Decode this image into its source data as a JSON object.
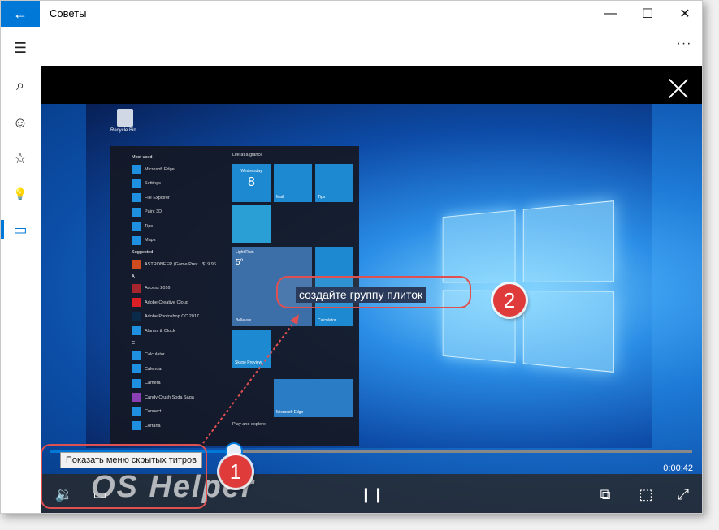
{
  "window": {
    "title": "Советы",
    "controls": {
      "minimize": "—",
      "maximize": "☐",
      "close": "✕"
    },
    "more": "···"
  },
  "nav": {
    "items": [
      {
        "icon": "hamburger-icon",
        "glyph": "☰"
      },
      {
        "icon": "search-icon",
        "glyph": "⌕"
      },
      {
        "icon": "smiley-icon",
        "glyph": "☺"
      },
      {
        "icon": "star-icon",
        "glyph": "☆"
      },
      {
        "icon": "lightbulb-icon",
        "glyph": "💡"
      },
      {
        "icon": "video-icon",
        "glyph": "▭"
      }
    ],
    "active_index": 5
  },
  "video": {
    "subtitle": "создайте группу плиток",
    "tooltip": "Показать меню скрытых титров",
    "time": "0:00:42",
    "progress_fraction": 0.28,
    "badges": {
      "one": "1",
      "two": "2"
    },
    "watermark": "OS Helper"
  },
  "desktop": {
    "recycle_bin": "Recycle Bin",
    "start_menu": {
      "sections": [
        {
          "header": "Most used",
          "apps": [
            "Microsoft Edge",
            "Settings",
            "File Explorer",
            "Paint 3D",
            "Tips",
            "Maps"
          ]
        },
        {
          "header": "Suggested",
          "apps": [
            "ASTRONEER (Game Prev...  $19.96"
          ]
        },
        {
          "header": "A",
          "apps": [
            "Access 2016",
            "Adobe Creative Cloud",
            "Adobe Photoshop CC 2017",
            "Alarms & Clock"
          ]
        },
        {
          "header": "C",
          "apps": [
            "Calculator",
            "Calendar",
            "Camera",
            "Candy Crush Soda Saga",
            "Connect",
            "Cortana"
          ]
        }
      ],
      "tiles_header": "Life at a glance",
      "tiles": {
        "calendar_day": "Wednesday",
        "calendar_date": "8",
        "mail": "Mail",
        "tips": "Tips",
        "weather_title": "Light Rain",
        "weather_temp": "5°",
        "weather_city": "Bellevue",
        "calculator": "Calculator",
        "skype": "Skype Preview",
        "edge": "Microsoft Edge",
        "play_header": "Play and explore"
      }
    }
  }
}
